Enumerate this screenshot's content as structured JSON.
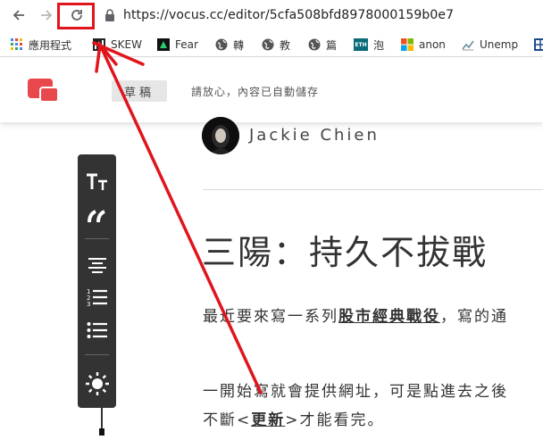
{
  "browser": {
    "url": "https://vocus.cc/editor/5cfa508bfd8978000159b0e7",
    "back_icon": "arrow-left-icon",
    "forward_icon": "arrow-right-icon",
    "reload_icon": "reload-icon"
  },
  "bookmarks": [
    {
      "label": "應用程式",
      "icon": "apps-grid-icon"
    },
    {
      "label": "SKEW",
      "icon": "bar-chart-icon"
    },
    {
      "label": "Fear",
      "icon": "triangle-icon"
    },
    {
      "label": "轉",
      "icon": "globe-icon"
    },
    {
      "label": "教",
      "icon": "globe-icon"
    },
    {
      "label": "篇",
      "icon": "globe-icon"
    },
    {
      "label": "泡",
      "icon": "eth-icon",
      "icon_text": "ETH"
    },
    {
      "label": "anon",
      "icon": "windows-icon"
    },
    {
      "label": "Unemp",
      "icon": "line-chart-icon"
    }
  ],
  "editor": {
    "draft_label": "草稿",
    "autosave_text": "請放心，內容已自動儲存",
    "author_name": "Jackie Chien",
    "title": "三陽：持久不拔戰",
    "paragraphs": {
      "p1_before": "最近要來寫一系列",
      "p1_bold": "股市經典戰役",
      "p1_after": "，寫的通",
      "p2_line1": "一開始寫就會提供網址，可是點進去之後",
      "p3_before": "不斷<",
      "p3_bold": "更新",
      "p3_after": ">才能看完。"
    }
  },
  "toolbar": {
    "text_size_icon": "text-size-icon",
    "quote_icon": "quote-icon",
    "align_center_icon": "align-center-icon",
    "ordered_list_icon": "ordered-list-icon",
    "bullet_list_icon": "bullet-list-icon",
    "brightness_icon": "brightness-icon"
  },
  "colors": {
    "annotation_red": "#e0151c",
    "toolbar_bg": "#333333",
    "logo_red": "#e8474c"
  }
}
